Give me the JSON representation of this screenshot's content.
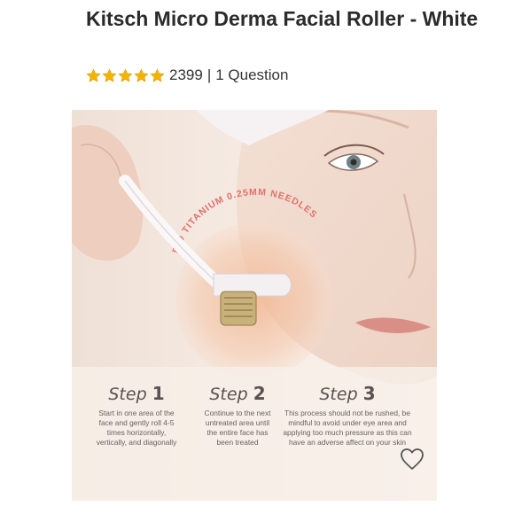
{
  "product": {
    "title": "Kitsch Micro Derma Facial Roller - White",
    "rating_count": "2399",
    "separator": "|",
    "questions": "1 Question",
    "stars": 5,
    "star_color": "#f5b301"
  },
  "image": {
    "arc_text": "540 TITANIUM 0.25MM NEEDLES",
    "steps": [
      {
        "word": "Step",
        "num": "1",
        "lines": [
          "Start in one area of the",
          "face and gently roll 4-5",
          "times horizontally,",
          "vertically, and diagonally"
        ]
      },
      {
        "word": "Step",
        "num": "2",
        "lines": [
          "Continue to the next",
          "untreated area until",
          "the entire face has",
          "been treated"
        ]
      },
      {
        "word": "Step",
        "num": "3",
        "lines": [
          "This process should not be rushed, be",
          "mindful to avoid under eye area and",
          "applying too much pressure as this can",
          "have an adverse affect on your skin"
        ]
      }
    ]
  },
  "actions": {
    "like_icon": "heart-outline"
  },
  "colors": {
    "arc_text": "#e0706a",
    "glow": "#f2b58f"
  }
}
